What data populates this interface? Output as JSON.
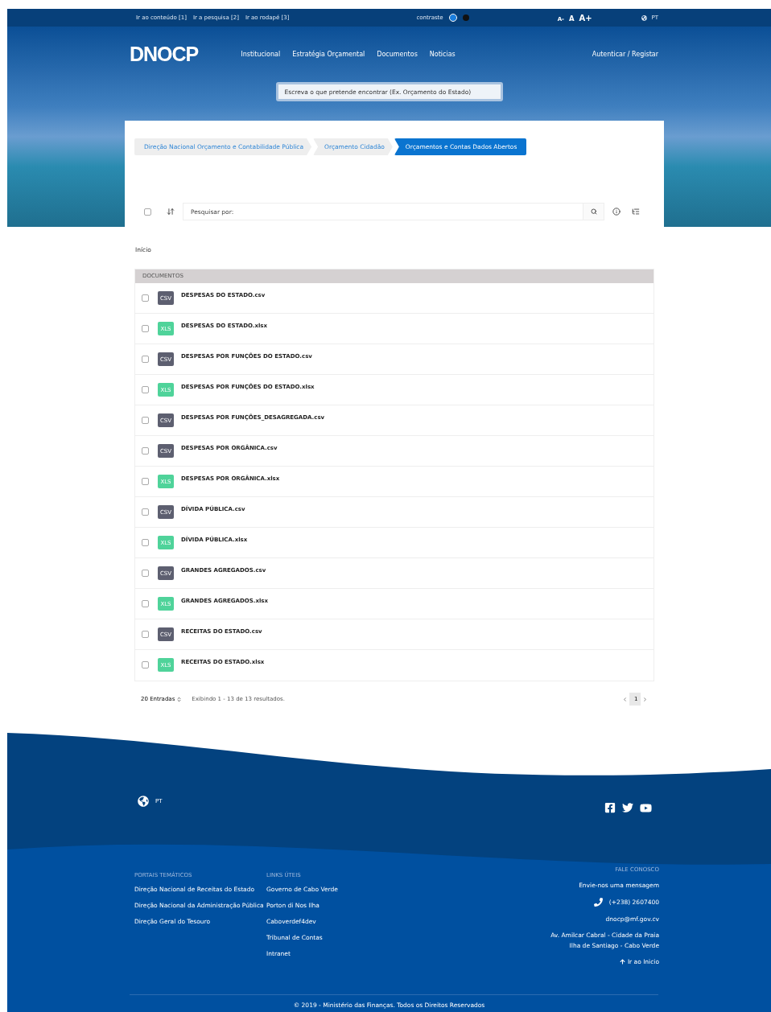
{
  "top_bar": {
    "skip_links": [
      "Ir ao conteúdo [1]",
      "Ir a pesquisa [2]",
      "Ir ao rodapé [3]"
    ],
    "contrast_label": "contraste",
    "contrast_options": [
      {
        "color": "#1a7fe0",
        "selected": true
      },
      {
        "color": "#111111",
        "selected": false
      }
    ],
    "font_sizes": [
      "A-",
      "A",
      "A+"
    ],
    "language": "PT"
  },
  "header": {
    "logo": "DNOCP",
    "nav": [
      "Institucional",
      "Estratégia Orçamental",
      "Documentos",
      "Noticias"
    ],
    "login": "Autenticar / Registar",
    "search_placeholder": "Escreva o que pretende encontrar (Ex. Orçamento do Estado)"
  },
  "breadcrumb": [
    {
      "label": "Direção Nacional Orçamento e Contabilidade Pública",
      "selected": false
    },
    {
      "label": "Orçamento Cidadão",
      "selected": false
    },
    {
      "label": "Orçamentos e Contas Dados Abertos",
      "selected": true
    }
  ],
  "toolbar": {
    "select_all_checked": false,
    "search_placeholder": "Pesquisar por:"
  },
  "path": "Início",
  "table": {
    "header": "DOCUMENTOS",
    "rows": [
      {
        "name": "DESPESAS DO ESTADO.csv",
        "kind": "csv",
        "badge": "CSV",
        "checked": false
      },
      {
        "name": "DESPESAS DO ESTADO.xlsx",
        "kind": "xls",
        "badge": "XLS",
        "checked": false
      },
      {
        "name": "DESPESAS POR FUNÇÕES DO ESTADO.csv",
        "kind": "csv",
        "badge": "CSV",
        "checked": false
      },
      {
        "name": "DESPESAS POR FUNÇÕES DO ESTADO.xlsx",
        "kind": "xls",
        "badge": "XLS",
        "checked": false
      },
      {
        "name": "DESPESAS POR FUNÇÕES_DESAGREGADA.csv",
        "kind": "csv",
        "badge": "CSV",
        "checked": false
      },
      {
        "name": "DESPESAS POR ORGÂNICA.csv",
        "kind": "csv",
        "badge": "CSV",
        "checked": false
      },
      {
        "name": "DESPESAS POR ORGÂNICA.xlsx",
        "kind": "xls",
        "badge": "XLS",
        "checked": false
      },
      {
        "name": "DÍVIDA PÚBLICA.csv",
        "kind": "csv",
        "badge": "CSV",
        "checked": false
      },
      {
        "name": "DÍVIDA PÚBLICA.xlsx",
        "kind": "xls",
        "badge": "XLS",
        "checked": false
      },
      {
        "name": "GRANDES AGREGADOS.csv",
        "kind": "csv",
        "badge": "CSV",
        "checked": false
      },
      {
        "name": "GRANDES AGREGADOS.xlsx",
        "kind": "xls",
        "badge": "XLS",
        "checked": false
      },
      {
        "name": "RECEITAS DO ESTADO.csv",
        "kind": "csv",
        "badge": "CSV",
        "checked": false
      },
      {
        "name": "RECEITAS DO ESTADO.xlsx",
        "kind": "xls",
        "badge": "XLS",
        "checked": false
      }
    ]
  },
  "pagination": {
    "page_size": "20 Entradas",
    "summary": "Exibindo 1 - 13 de 13 resultados.",
    "pages": [
      {
        "label": "1",
        "selected": true
      }
    ]
  },
  "footer": {
    "language": "PT",
    "columns": [
      {
        "title": "PORTAIS TEMÁTICOS",
        "links": [
          "Direção Nacional de Receitas do Estado",
          "Direção Nacional da Administração Pública",
          "Direção Geral do Tesouro"
        ]
      },
      {
        "title": "LINKS ÚTEIS",
        "links": [
          "Governo de Cabo Verde",
          "Porton di Nos Ilha",
          "Caboverdef4dev",
          "Tribunal de Contas",
          "Intranet"
        ]
      }
    ],
    "contact": {
      "title": "FALE CONOSCO",
      "message": "Envie-nos uma mensagem",
      "phone": "(+238) 2607400",
      "email": "dnocp@mf.gov.cv",
      "address": [
        "Av. Amilcar Cabral - Cidade da Praia",
        "Ilha de Santiago - Cabo Verde"
      ],
      "back_to_top": "Ir ao Inicio"
    },
    "copyright": "© 2019 - Ministério das Finanças. Todos os Direitos Reservados"
  }
}
